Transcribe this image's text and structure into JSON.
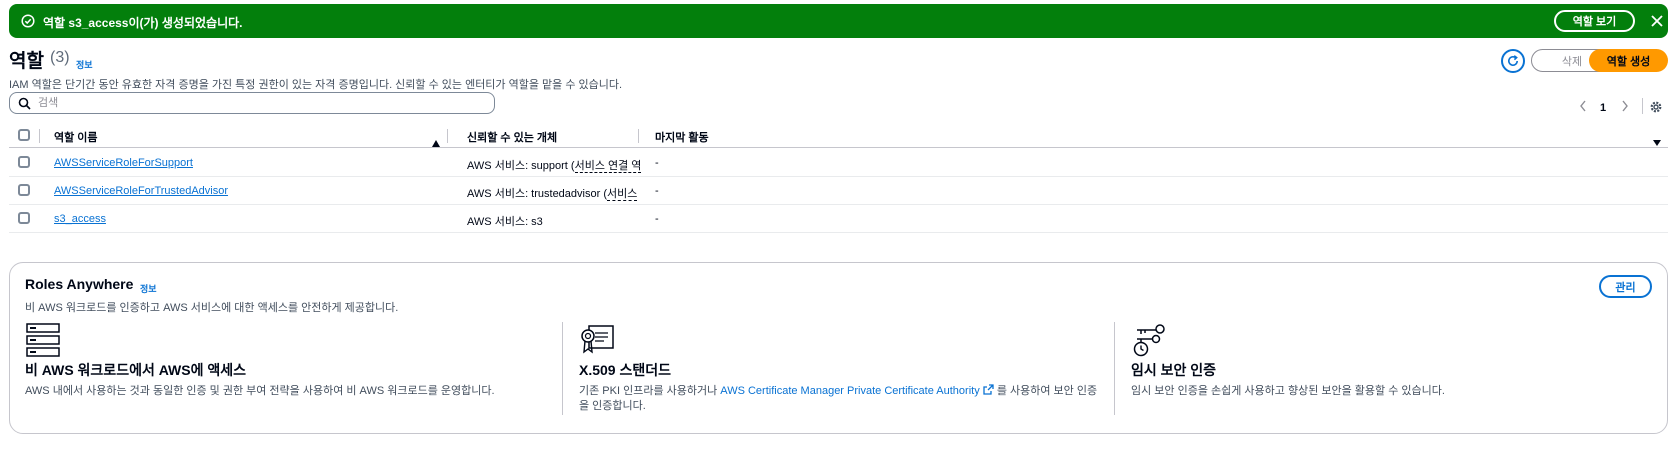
{
  "flash": {
    "message": "역할 s3_access이(가) 생성되었습니다.",
    "view_button": "역할 보기"
  },
  "header": {
    "title": "역할",
    "count": "(3)",
    "info": "정보",
    "description": "IAM 역할은 단기간 동안 유효한 자격 증명을 가진 특정 권한이 있는 자격 증명입니다. 신뢰할 수 있는 엔터티가 역할을 맡을 수 있습니다.",
    "delete_button": "삭제",
    "create_button": "역할 생성"
  },
  "search": {
    "placeholder": "검색",
    "value": ""
  },
  "pagination": {
    "current_page": "1"
  },
  "table": {
    "columns": [
      "역할 이름",
      "신뢰할 수 있는 개체",
      "마지막 활동"
    ],
    "rows": [
      {
        "name": "AWSServiceRoleForSupport",
        "trust_prefix": "AWS 서비스: support (",
        "trust_suffix": "서비스 연결 역",
        "last_activity": "-"
      },
      {
        "name": "AWSServiceRoleForTrustedAdvisor",
        "trust_prefix": "AWS 서비스: trustedadvisor (",
        "trust_suffix": "서비스 ",
        "last_activity": "-"
      },
      {
        "name": "s3_access",
        "trust_prefix": "AWS 서비스: s3",
        "trust_suffix": "",
        "last_activity": "-"
      }
    ]
  },
  "roles_anywhere": {
    "title": "Roles Anywhere",
    "info": "정보",
    "description": "비 AWS 워크로드를 인증하고 AWS 서비스에 대한 액세스를 안전하게 제공합니다.",
    "manage_button": "관리",
    "columns": [
      {
        "icon": "server-stack-icon",
        "title": "비 AWS 워크로드에서 AWS에 액세스",
        "description": "AWS 내에서 사용하는 것과 동일한 인증 및 권한 부여 전략을 사용하여 비 AWS 워크로드를 운영합니다."
      },
      {
        "icon": "certificate-icon",
        "title": "X.509 스탠더드",
        "description_prefix": "기존 PKI 인프라를 사용하거나 ",
        "link": "AWS Certificate Manager Private Certificate Authority",
        "description_suffix_line1": " 를 사용하여 보안 인증",
        "description_line2": "을 인증합니다."
      },
      {
        "icon": "keys-clock-icon",
        "title": "임시 보안 인증",
        "description": "임시 보안 인증을 손쉽게 사용하고 향상된 보안을 활용할 수 있습니다."
      }
    ]
  },
  "colors": {
    "success": "#037f0c",
    "primary": "#ff9900",
    "link": "#0972d3"
  }
}
